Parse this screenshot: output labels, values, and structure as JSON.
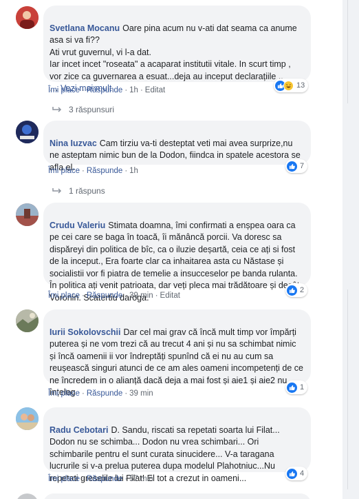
{
  "actions": {
    "like": "Îmi place",
    "reply": "Răspunde",
    "edited": "Editat"
  },
  "comments": [
    {
      "author": "Svetlana Mocanu",
      "text": "Oare pina acum nu v-ati dat seama ca anume asa si va fi??\nAti vrut guvernul, vi l-a dat.\nIar incet incet \"roseata\" a acaparat institutii vitale. In scurt timp , vor zice ca guvernarea a esuat...deja au inceput declarațiile ..\n… ",
      "see_more": "Vezi mai mult",
      "time": "1h",
      "reaction_count": "13",
      "replies": "3 răspunsuri",
      "avatar_color": "#b8322f"
    },
    {
      "author": "Nina Iuzvac",
      "text": "Cam tirziu va-ti desteptat veti mai avea surprize,nu ne asteptam nimic bun de la Dodon, fiindca in spatele acestora se afla el.",
      "time": "1h",
      "reaction_count": "7",
      "replies": "1 răspuns",
      "avatar_color": "#1f2a5c"
    },
    {
      "author": "Crudu Valeriu",
      "text": "Stimata doamna, îmi confirmati a enșpea oara ca pe cei care se baga în toacă, îi mănâncă porcii. Va doresc sa dispăreyi din politica de bîc, ca o iluzie deșartă, ceia ce ați si fost de la inceput., Era foarte clar ca inhaitarea asta cu Năstase și socialistii vor fi piatra de temelie a insucceselor pe banda rulanta. În politica ați venit patrioata, dar veți pleca mai trădătoare și decât Voronin. Scatertiu daroga.",
      "time": "39 min",
      "reaction_count": "2",
      "avatar_color": "#a2524a"
    },
    {
      "author": "Iurii Sokolovschii",
      "text": "Dar cel mai grav că încă mult timp vor împărți puterea și ne vom trezi că au trecut 4 ani și nu sa schimbat nimic și încă oamenii ii vor îndreptăți spunînd că ei nu au cum sa reușească singuri atunci de ce am ales oameni incompetenți de ce ne încredem in o alianță dacă deja a mai fost și aie1 și aie2 nu înțeleg",
      "time": "39 min",
      "reaction_count": "1",
      "avatar_color": "#6b7a5a"
    },
    {
      "author": "Radu Cebotari",
      "text": "D. Sandu, riscati sa repetati soarta lui Filat... Dodon nu se schimba... Dodon nu vrea schimbari... Ori schimbarile pentru el sunt curata sinucidere... V-a taragana lucrurile si v-a prelua puterea dupa modelul Plahotniuc...Nu repetati greselile lui Filat! El tot a crezut in oameni...",
      "time": "57 min",
      "reaction_count": "4",
      "avatar_color": "#5d8fb8"
    }
  ]
}
